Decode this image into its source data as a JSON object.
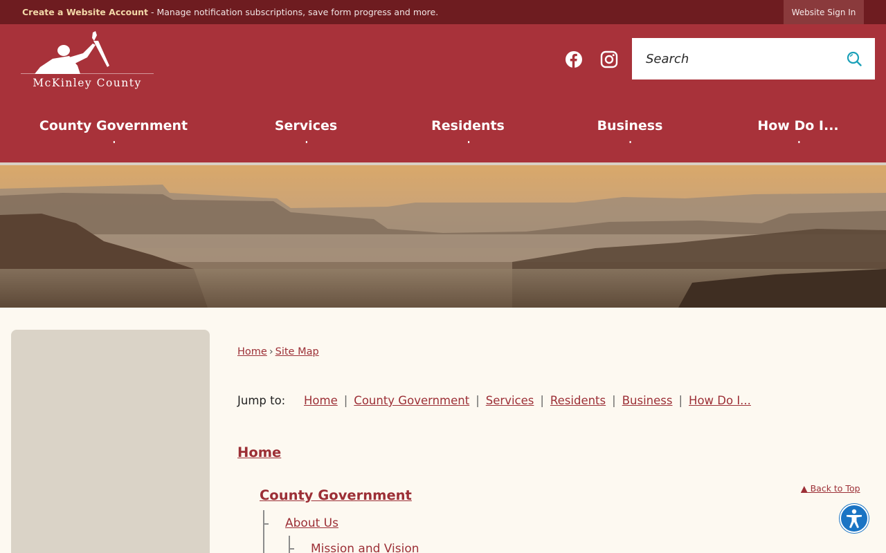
{
  "topbar": {
    "create_account": "Create a Website Account",
    "message": " - Manage notification subscriptions, save form progress and more.",
    "signin": "Website Sign In"
  },
  "header": {
    "logo_text": "McKinley County",
    "search_placeholder": "Search",
    "social": [
      "facebook-icon",
      "instagram-icon"
    ]
  },
  "nav": {
    "items": [
      "County Government",
      "Services",
      "Residents",
      "Business",
      "How Do I..."
    ]
  },
  "breadcrumb": {
    "home": "Home",
    "separator": "›",
    "current": "Site Map"
  },
  "jumpto": {
    "label": "Jump to:",
    "links": [
      "Home",
      "County Government",
      "Services",
      "Residents",
      "Business",
      "How Do I..."
    ],
    "separator": "|"
  },
  "sitemap": {
    "home": "Home",
    "county_government": "County Government",
    "about_us": "About Us",
    "mission_vision": "Mission and Vision",
    "back_to_top": "▲ Back to Top"
  },
  "colors": {
    "header": "#a8323a",
    "topbar": "#6e1c20",
    "link": "#9c2f36",
    "background": "#fdf9f1",
    "sidebar": "#dad3c7",
    "accessibility": "#1a74c4"
  }
}
